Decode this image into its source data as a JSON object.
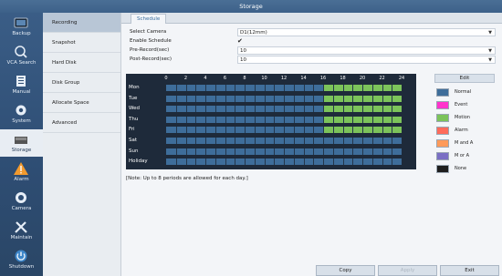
{
  "window": {
    "title": "Storage"
  },
  "leftnav": [
    {
      "label": "Backup",
      "icon": "backup-icon",
      "active": false
    },
    {
      "label": "VCA Search",
      "icon": "vca-search-icon",
      "active": false
    },
    {
      "label": "Manual",
      "icon": "manual-icon",
      "active": false
    },
    {
      "label": "System",
      "icon": "gear-icon",
      "active": false
    },
    {
      "label": "Storage",
      "icon": "storage-icon",
      "active": true
    },
    {
      "label": "Alarm",
      "icon": "alarm-icon",
      "active": false
    },
    {
      "label": "Camera",
      "icon": "camera-icon",
      "active": false
    },
    {
      "label": "Maintain",
      "icon": "maintain-icon",
      "active": false
    },
    {
      "label": "Shutdown",
      "icon": "power-icon",
      "active": false
    }
  ],
  "submenu": [
    {
      "label": "Recording",
      "active": true
    },
    {
      "label": "Snapshot",
      "active": false
    },
    {
      "label": "Hard Disk",
      "active": false
    },
    {
      "label": "Disk Group",
      "active": false
    },
    {
      "label": "Allocate Space",
      "active": false
    },
    {
      "label": "Advanced",
      "active": false
    }
  ],
  "tab": {
    "label": "Schedule"
  },
  "form": {
    "select_camera_label": "Select Camera",
    "select_camera_value": "D1(12mm)",
    "enable_schedule_label": "Enable Schedule",
    "enable_schedule_checked": "✔",
    "pre_record_label": "Pre-Record(sec)",
    "pre_record_value": "10",
    "post_record_label": "Post-Record(sec)",
    "post_record_value": "10"
  },
  "schedule": {
    "hours": [
      "0",
      "2",
      "4",
      "6",
      "8",
      "10",
      "12",
      "14",
      "16",
      "18",
      "20",
      "22",
      "24"
    ],
    "days": [
      {
        "name": "Mon",
        "motion_start": 16,
        "motion_end": 24
      },
      {
        "name": "Tue",
        "motion_start": 16,
        "motion_end": 24
      },
      {
        "name": "Wed",
        "motion_start": 16,
        "motion_end": 24
      },
      {
        "name": "Thu",
        "motion_start": 16,
        "motion_end": 24
      },
      {
        "name": "Fri",
        "motion_start": 16,
        "motion_end": 24
      },
      {
        "name": "Sat",
        "motion_start": null,
        "motion_end": null
      },
      {
        "name": "Sun",
        "motion_start": null,
        "motion_end": null
      },
      {
        "name": "Holiday",
        "motion_start": null,
        "motion_end": null
      }
    ],
    "normal_color": "#3e6d9a",
    "motion_color": "#7cc35a"
  },
  "note": "[Note: Up to 8 periods are allowed for each day.]",
  "legend": {
    "edit_label": "Edit",
    "items": [
      {
        "label": "Normal",
        "color": "#3e6d9a"
      },
      {
        "label": "Event",
        "color": "#ff33cc"
      },
      {
        "label": "Motion",
        "color": "#7cc35a"
      },
      {
        "label": "Alarm",
        "color": "#ff6b5b"
      },
      {
        "label": "M and A",
        "color": "#ff9a5a"
      },
      {
        "label": "M or A",
        "color": "#7a6fc4"
      },
      {
        "label": "None",
        "color": "#1e1e1e"
      }
    ]
  },
  "buttons": {
    "copy": "Copy",
    "apply": "Apply",
    "exit": "Exit"
  }
}
